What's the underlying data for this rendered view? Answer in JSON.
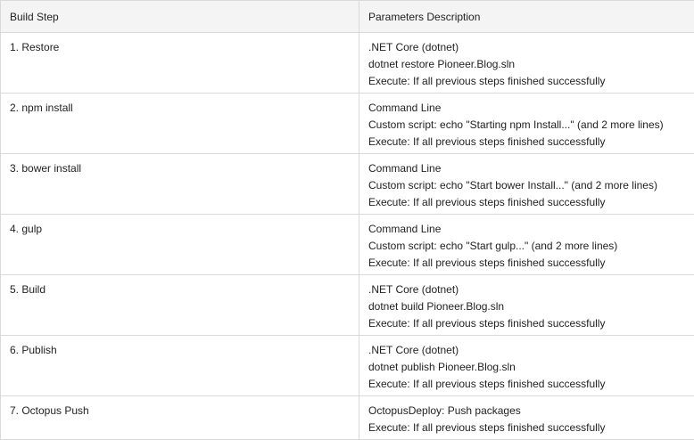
{
  "table": {
    "headers": [
      "Build Step",
      "Parameters Description"
    ],
    "rows": [
      {
        "step": "1. Restore",
        "lines": [
          ".NET Core (dotnet)",
          "dotnet restore Pioneer.Blog.sln",
          "Execute: If all previous steps finished successfully"
        ]
      },
      {
        "step": "2. npm install",
        "lines": [
          "Command Line",
          "Custom script: echo \"Starting npm Install...\" (and 2 more lines)",
          "Execute: If all previous steps finished successfully"
        ]
      },
      {
        "step": "3. bower install",
        "lines": [
          "Command Line",
          "Custom script: echo \"Start bower Install...\" (and 2 more lines)",
          "Execute: If all previous steps finished successfully"
        ]
      },
      {
        "step": "4. gulp",
        "lines": [
          "Command Line",
          "Custom script: echo \"Start gulp...\" (and 2 more lines)",
          "Execute: If all previous steps finished successfully"
        ]
      },
      {
        "step": "5. Build",
        "lines": [
          ".NET Core (dotnet)",
          "dotnet build Pioneer.Blog.sln",
          "Execute: If all previous steps finished successfully"
        ]
      },
      {
        "step": "6. Publish",
        "lines": [
          ".NET Core (dotnet)",
          "dotnet publish Pioneer.Blog.sln",
          "Execute: If all previous steps finished successfully"
        ]
      },
      {
        "step": "7. Octopus Push",
        "lines": [
          "OctopusDeploy: Push packages",
          "Execute: If all previous steps finished successfully"
        ]
      }
    ]
  }
}
